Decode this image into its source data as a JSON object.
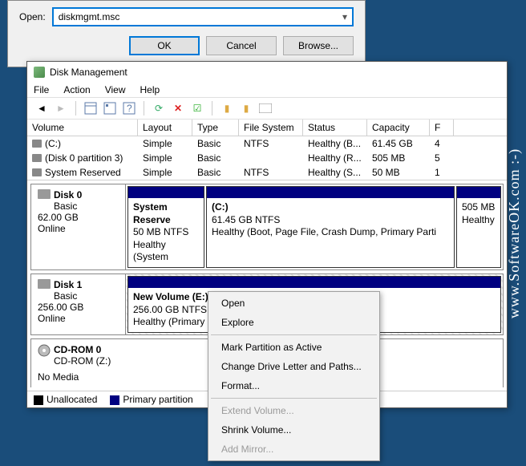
{
  "run": {
    "label": "Open:",
    "value": "diskmgmt.msc",
    "ok": "OK",
    "cancel": "Cancel",
    "browse": "Browse..."
  },
  "dm": {
    "title": "Disk Management",
    "menu": {
      "file": "File",
      "action": "Action",
      "view": "View",
      "help": "Help"
    },
    "columns": {
      "volume": "Volume",
      "layout": "Layout",
      "type": "Type",
      "fs": "File System",
      "status": "Status",
      "capacity": "Capacity",
      "extra": "F"
    },
    "rows": [
      {
        "volume": "(C:)",
        "layout": "Simple",
        "type": "Basic",
        "fs": "NTFS",
        "status": "Healthy (B...",
        "capacity": "61.45 GB",
        "extra": "4"
      },
      {
        "volume": "(Disk 0 partition 3)",
        "layout": "Simple",
        "type": "Basic",
        "fs": "",
        "status": "Healthy (R...",
        "capacity": "505 MB",
        "extra": "5"
      },
      {
        "volume": "System Reserved",
        "layout": "Simple",
        "type": "Basic",
        "fs": "NTFS",
        "status": "Healthy (S...",
        "capacity": "50 MB",
        "extra": "1"
      }
    ],
    "disks": [
      {
        "name": "Disk 0",
        "type": "Basic",
        "size": "62.00 GB",
        "state": "Online",
        "parts": [
          {
            "title": "System Reserve",
            "l2": "50 MB NTFS",
            "l3": "Healthy (System"
          },
          {
            "title": "(C:)",
            "l2": "61.45 GB NTFS",
            "l3": "Healthy (Boot, Page File, Crash Dump, Primary Parti"
          },
          {
            "title": "",
            "l2": "505 MB",
            "l3": "Healthy"
          }
        ]
      },
      {
        "name": "Disk 1",
        "type": "Basic",
        "size": "256.00 GB",
        "state": "Online",
        "parts": [
          {
            "title": "New Volume  (E:)",
            "l2": "256.00 GB NTFS",
            "l3": "Healthy (Primary P"
          }
        ]
      },
      {
        "name": "CD-ROM 0",
        "type": "CD-ROM (Z:)",
        "size": "",
        "state": "No Media",
        "parts": []
      }
    ],
    "legend": {
      "unalloc": "Unallocated",
      "primary": "Primary partition"
    }
  },
  "ctx": {
    "open": "Open",
    "explore": "Explore",
    "mark": "Mark Partition as Active",
    "letter": "Change Drive Letter and Paths...",
    "format": "Format...",
    "extend": "Extend Volume...",
    "shrink": "Shrink Volume...",
    "mirror": "Add Mirror..."
  },
  "watermark": "www.SoftwareOK.com  :-)"
}
